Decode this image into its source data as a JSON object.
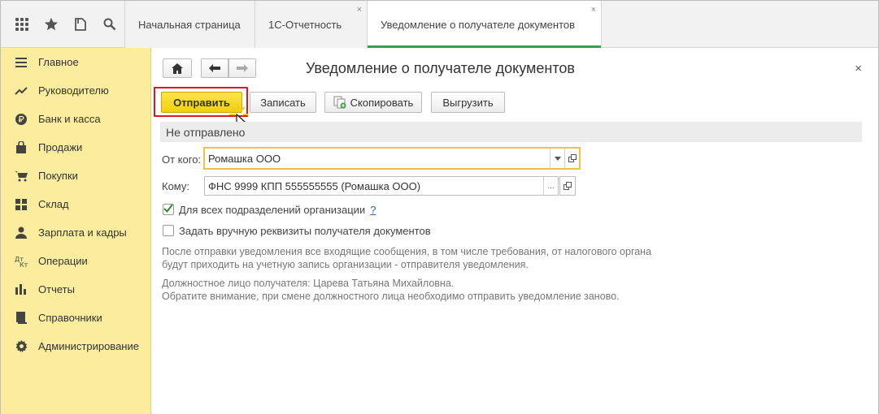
{
  "topbar": {
    "icons": [
      "apps-grid-icon",
      "favorites-star-icon",
      "history-icon",
      "search-icon"
    ],
    "tabs": [
      {
        "label": "Начальная страница"
      },
      {
        "label": "1С-Отчетность",
        "close": "×"
      },
      {
        "label": "Уведомление о получателе документов",
        "close": "×"
      }
    ]
  },
  "sidebar": {
    "items": [
      {
        "label": "Главное",
        "icon": "menu-lines-icon"
      },
      {
        "label": "Руководителю",
        "icon": "trend-chart-icon"
      },
      {
        "label": "Банк и касса",
        "icon": "ruble-coin-icon"
      },
      {
        "label": "Продажи",
        "icon": "shopping-bag-icon"
      },
      {
        "label": "Покупки",
        "icon": "cart-icon"
      },
      {
        "label": "Склад",
        "icon": "warehouse-grid-icon"
      },
      {
        "label": "Зарплата и кадры",
        "icon": "person-icon"
      },
      {
        "label": "Операции",
        "icon": "debit-credit-icon"
      },
      {
        "label": "Отчеты",
        "icon": "bar-chart-icon"
      },
      {
        "label": "Справочники",
        "icon": "book-icon"
      },
      {
        "label": "Администрирование",
        "icon": "gear-icon"
      }
    ]
  },
  "form": {
    "title": "Уведомление о получателе документов",
    "close": "×",
    "buttons": {
      "send": "Отправить",
      "save": "Записать",
      "copy": "Скопировать",
      "export": "Выгрузить"
    },
    "status": "Не отправлено",
    "from_label": "От кого:",
    "from_value": "Ромашка ООО",
    "to_label": "Кому:",
    "to_value": "ФНС 9999 КПП 555555555 (Ромашка ООО)",
    "to_select": "...",
    "check_all_divisions": "Для всех подразделений организации",
    "check_all_divisions_checked": true,
    "help_mark": "?",
    "check_manual": "Задать вручную реквизиты получателя документов",
    "check_manual_checked": false,
    "hint1_line1": "После отправки уведомления все входящие сообщения, в том числе требования, от налогового органа",
    "hint1_line2": "будут приходить на учетную запись организации - отправителя уведомления.",
    "hint2_line1": "Должностное лицо получателя: Царева Татьяна Михайловна.",
    "hint2_line2": "Обратите внимание, при смене должностного лица необходимо отправить уведомление заново."
  },
  "colors": {
    "sidebar_bg": "#fbec9e",
    "primary_button": "#f6d51f",
    "highlight_frame": "#e0161b",
    "active_tab_accent": "#2ea44f",
    "focused_field_border": "#f0c04a",
    "help_link": "#2a64b8"
  }
}
